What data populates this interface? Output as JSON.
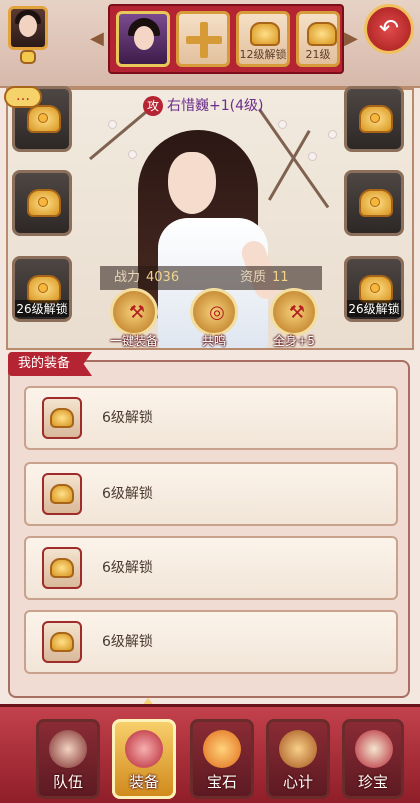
{
  "header": {
    "hero_slots": [
      {
        "label": ""
      },
      {
        "label": ""
      },
      {
        "label": "12级解锁"
      },
      {
        "label": "21级"
      }
    ],
    "arrows": {
      "left": "◀",
      "right": "▶"
    },
    "back_icon": "↶"
  },
  "character": {
    "name_icon": "攻",
    "name": "右惜巍+1(4级)",
    "power_label": "战力",
    "power_value": "4036",
    "aptitude_label": "资质",
    "aptitude_value": "11"
  },
  "side_slots": {
    "left": [
      {
        "label": ""
      },
      {
        "label": ""
      },
      {
        "label": "26级解锁"
      }
    ],
    "right": [
      {
        "label": ""
      },
      {
        "label": ""
      },
      {
        "label": "26级解锁"
      }
    ]
  },
  "actions": [
    {
      "label": "一键装备",
      "glyph": "⚒"
    },
    {
      "label": "共鸣",
      "glyph": "◎"
    },
    {
      "label": "全身+5",
      "glyph": "⚒"
    }
  ],
  "my_equipment": {
    "title": "我的装备",
    "rows": [
      {
        "text": "6级解锁"
      },
      {
        "text": "6级解锁"
      },
      {
        "text": "6级解锁"
      },
      {
        "text": "6级解锁"
      }
    ]
  },
  "bottom_nav": [
    {
      "label": "队伍",
      "active": false
    },
    {
      "label": "装备",
      "active": true
    },
    {
      "label": "宝石",
      "active": false
    },
    {
      "label": "心计",
      "active": false
    },
    {
      "label": "珍宝",
      "active": false
    }
  ],
  "colors": {
    "accent_red": "#b52432",
    "gold": "#d89b3a",
    "panel_bg": "#f0dcd2"
  }
}
